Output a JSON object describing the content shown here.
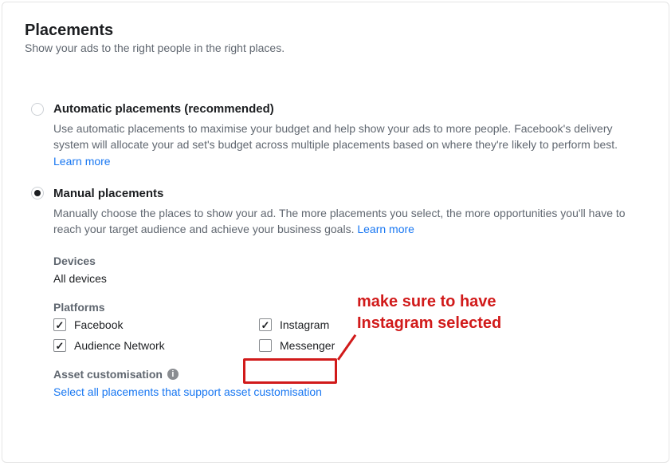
{
  "heading": "Placements",
  "subtitle": "Show your ads to the right people in the right places.",
  "options": {
    "automatic": {
      "label": "Automatic placements (recommended)",
      "desc": "Use automatic placements to maximise your budget and help show your ads to more people. Facebook's delivery system will allocate your ad set's budget across multiple placements based on where they're likely to perform best.",
      "learn_more": "Learn more"
    },
    "manual": {
      "label": "Manual placements",
      "desc": "Manually choose the places to show your ad. The more placements you select, the more opportunities you'll have to reach your target audience and achieve your business goals.",
      "learn_more": "Learn more"
    }
  },
  "devices": {
    "label": "Devices",
    "value": "All devices"
  },
  "platforms": {
    "label": "Platforms",
    "items": [
      {
        "name": "Facebook",
        "checked": true
      },
      {
        "name": "Instagram",
        "checked": true
      },
      {
        "name": "Audience Network",
        "checked": true
      },
      {
        "name": "Messenger",
        "checked": false
      }
    ]
  },
  "asset": {
    "label": "Asset customisation",
    "link": "Select all placements that support asset customisation"
  },
  "annotation": {
    "text": "make sure to have Instagram selected"
  }
}
